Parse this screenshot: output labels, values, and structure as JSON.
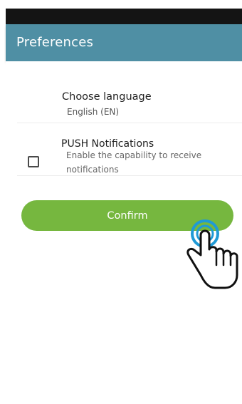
{
  "header": {
    "title": "Preferences"
  },
  "preferences": {
    "language": {
      "title": "Choose language",
      "value": "English (EN)"
    },
    "push": {
      "title": "PUSH Notifications",
      "description": "Enable the capability to receive notifications",
      "checked": false
    }
  },
  "actions": {
    "confirm_label": "Confirm"
  },
  "icons": {
    "tap_gesture": "hand-tap-icon"
  },
  "colors": {
    "app_bar": "#4f8fa4",
    "confirm_button": "#76b73f",
    "tap_indicator": "#1f9ad6"
  }
}
